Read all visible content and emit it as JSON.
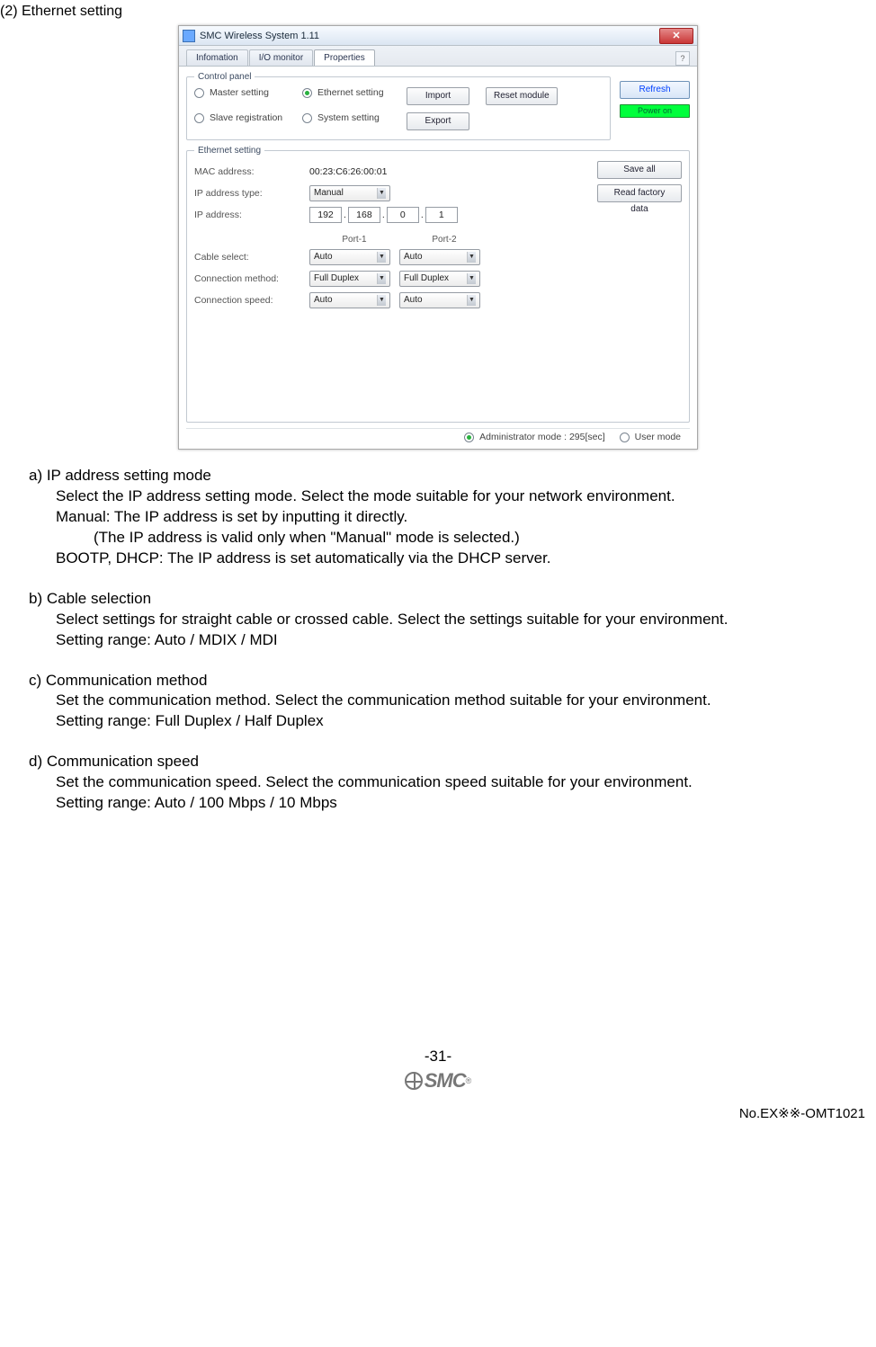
{
  "heading": "(2) Ethernet setting",
  "window": {
    "title": "SMC Wireless System 1.11",
    "tabs": [
      "Infomation",
      "I/O monitor",
      "Properties"
    ],
    "active_tab": 2,
    "help": "?",
    "control_panel_legend": "Control panel",
    "radios": {
      "master": "Master setting",
      "slave": "Slave registration",
      "ethernet": "Ethernet setting",
      "system": "System setting"
    },
    "buttons": {
      "import": "Import",
      "export": "Export",
      "reset": "Reset module",
      "refresh": "Refresh",
      "saveall": "Save all",
      "readfactory": "Read factory data"
    },
    "power": "Power on",
    "eth_legend": "Ethernet setting",
    "fields": {
      "mac_label": "MAC address:",
      "mac_value": "00:23:C6:26:00:01",
      "iptype_label": "IP address type:",
      "iptype_value": "Manual",
      "ip_label": "IP address:",
      "ip": [
        "192",
        "168",
        "0",
        "1"
      ],
      "port1": "Port-1",
      "port2": "Port-2",
      "cable_label": "Cable select:",
      "cable_v": "Auto",
      "conn_label": "Connection method:",
      "conn_v": "Full Duplex",
      "speed_label": "Connection speed:",
      "speed_v": "Auto"
    },
    "status": {
      "admin": "Administrator mode : 295[sec]",
      "user": "User mode"
    }
  },
  "desc": {
    "a_title": "a) IP address setting mode",
    "a_l1": "Select the IP address setting mode. Select the mode suitable for your network environment.",
    "a_l2": "Manual: The IP address is set by inputting it directly.",
    "a_l3": "(The IP address is valid only when \"Manual\" mode is selected.)",
    "a_l4": "BOOTP, DHCP: The IP address is set automatically via the DHCP server.",
    "b_title": "b) Cable selection",
    "b_l1": "Select settings for straight cable or crossed cable. Select the settings suitable for your environment.",
    "b_l2": "Setting range: Auto / MDIX / MDI",
    "c_title": "c) Communication method",
    "c_l1": "Set the communication method. Select the communication method suitable for your environment.",
    "c_l2": "Setting range: Full Duplex / Half Duplex",
    "d_title": "d) Communication speed",
    "d_l1": "Set the communication speed. Select the communication speed suitable for your environment.",
    "d_l2": "Setting range: Auto / 100 Mbps / 10 Mbps"
  },
  "footer": {
    "page": "-31-",
    "logo_text": "SMC",
    "doc_no": "No.EX※※-OMT1021"
  }
}
